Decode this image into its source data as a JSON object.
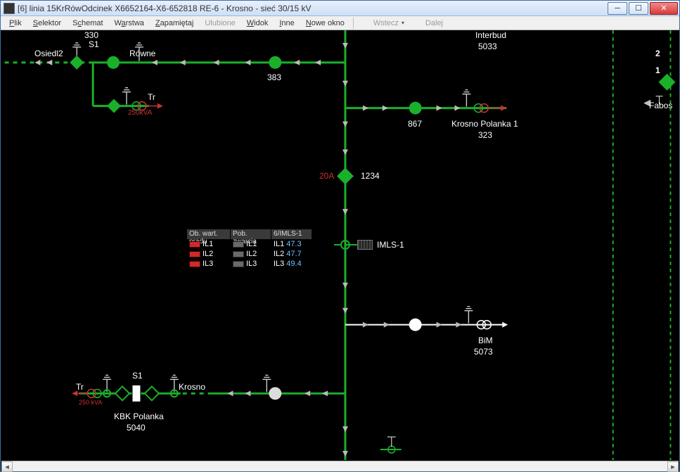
{
  "window": {
    "title": "[6]  linia 15KrRówOdcinek X6652164-X6-652818   RE-6 - Krosno - sieć 30/15 kV"
  },
  "menu": {
    "items": [
      "Plik",
      "Selektor",
      "Schemat",
      "Warstwa",
      "Zapamiętaj",
      "Ulubione",
      "Widok",
      "Inne",
      "Nowe okno"
    ],
    "disabled_index": 5,
    "nav_back": "Wstecz",
    "nav_fwd": "Dalej"
  },
  "labels": {
    "n330": "330",
    "s1_top": "S1",
    "osiedl2": "Osiedl2",
    "rowne": "Równe",
    "tr_top": "Tr",
    "trafo_top": "250kVA",
    "n383": "383",
    "interbud": "Interbud",
    "n5033": "5033",
    "fabos": "Fabos",
    "right_12": "1",
    "right_2": "2",
    "n867": "867",
    "krosno_polanka1": "Krosno Polanka 1",
    "n323": "323",
    "a20": "20A",
    "n1234": "1234",
    "imls": "IMLS-1",
    "bim": "BiM",
    "n5073": "5073",
    "s1_bot": "S1",
    "tr_bot": "Tr",
    "trafo_bot": "250 kVA",
    "krosno": "Krosno",
    "kbk": "KBK Polanka",
    "n5040": "5040"
  },
  "measure": {
    "hdr": [
      "Ob. wart. prądu",
      "Pob. zwarcia",
      "6/IMLS-1"
    ],
    "rows": [
      {
        "c1": "IL1",
        "c2": "IL1",
        "c3": "IL1",
        "v": "47.3"
      },
      {
        "c1": "IL2",
        "c2": "IL2",
        "c3": "IL2",
        "v": "47.7"
      },
      {
        "c1": "IL3",
        "c2": "IL3",
        "c3": "IL3",
        "v": "49.4"
      }
    ]
  },
  "colors": {
    "line_green": "#1ab02a",
    "line_bright": "#28d83a",
    "white": "#ffffff",
    "red": "#c83232",
    "blue": "#6fc2ff"
  }
}
